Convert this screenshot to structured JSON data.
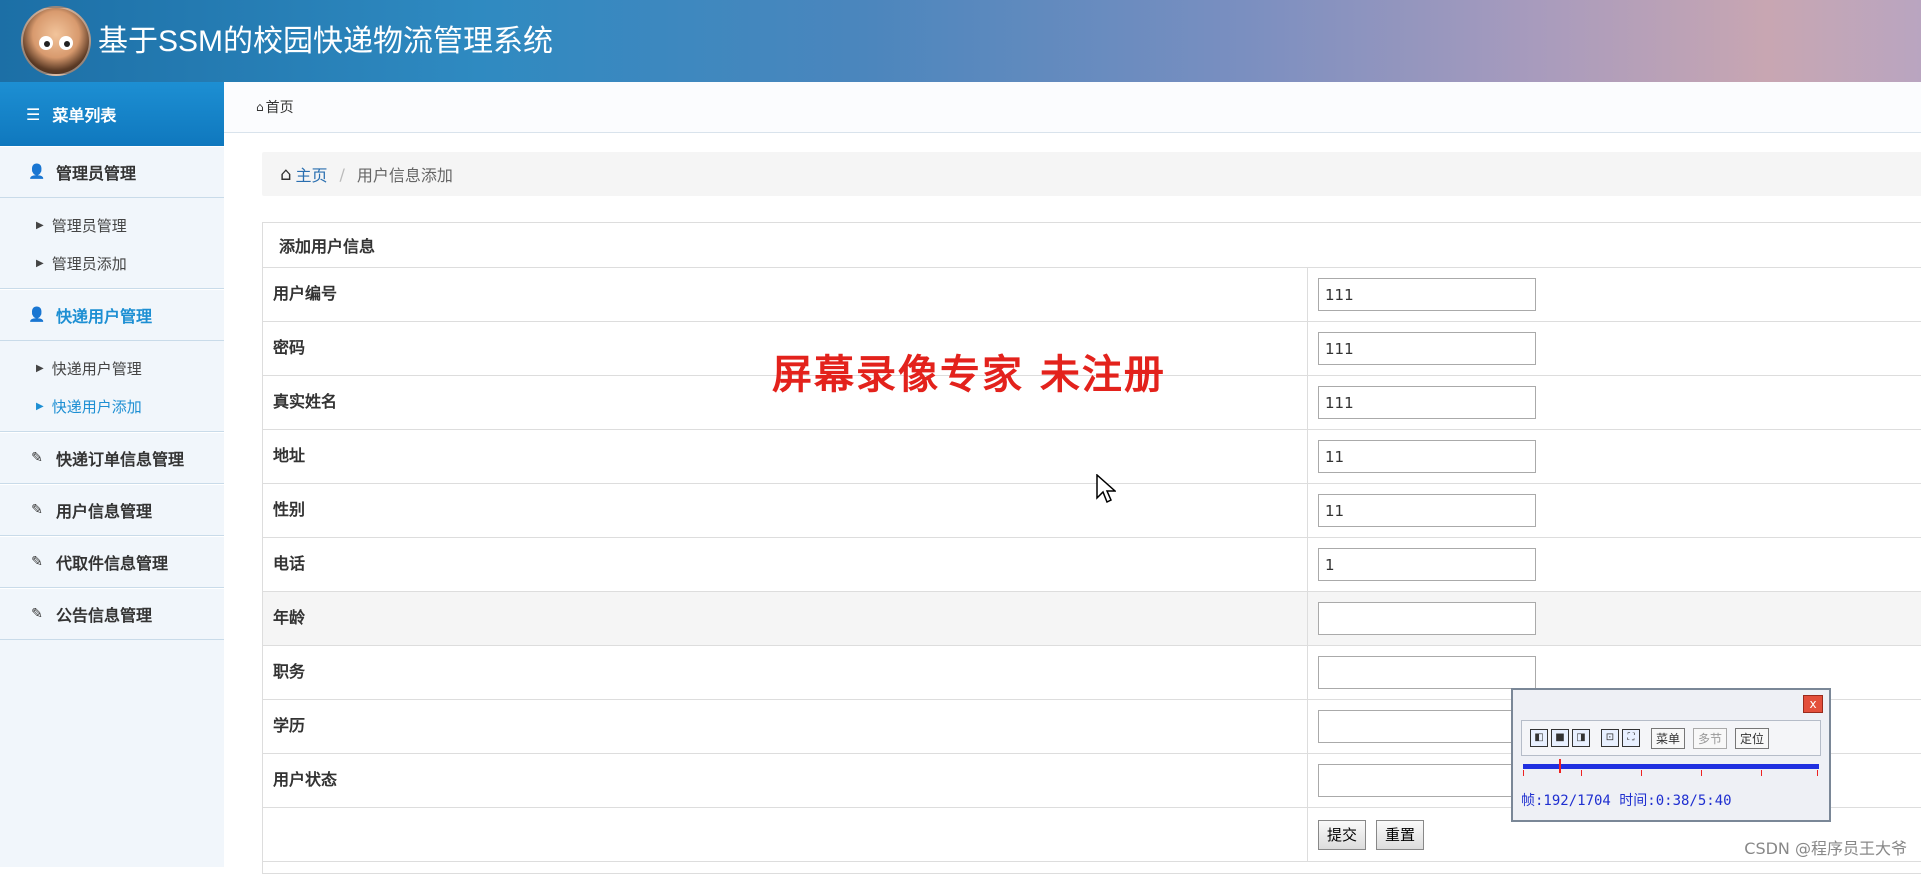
{
  "header": {
    "title": "基于SSM的校园快递物流管理系统"
  },
  "sidebar": {
    "head": {
      "label": "菜单列表",
      "icon": "list-icon"
    },
    "groups": [
      {
        "label": "管理员管理",
        "icon": "user-icon",
        "items": [
          "管理员管理",
          "管理员添加"
        ]
      },
      {
        "label": "快递用户管理",
        "icon": "user-icon",
        "items": [
          "快递用户管理",
          "快递用户添加"
        ],
        "active_item": 1
      },
      {
        "label": "快递订单信息管理",
        "icon": "edit-icon"
      },
      {
        "label": "用户信息管理",
        "icon": "edit-icon"
      },
      {
        "label": "代取件信息管理",
        "icon": "edit-icon"
      },
      {
        "label": "公告信息管理",
        "icon": "edit-icon"
      }
    ]
  },
  "topbar": {
    "home_label": "首页"
  },
  "breadcrumb": {
    "home": "主页",
    "current": "用户信息添加"
  },
  "form": {
    "title": "添加用户信息",
    "fields": [
      {
        "label": "用户编号",
        "value": "111"
      },
      {
        "label": "密码",
        "value": "111"
      },
      {
        "label": "真实姓名",
        "value": "111"
      },
      {
        "label": "地址",
        "value": "11"
      },
      {
        "label": "性别",
        "value": "11"
      },
      {
        "label": "电话",
        "value": "1"
      },
      {
        "label": "年龄",
        "value": ""
      },
      {
        "label": "职务",
        "value": ""
      },
      {
        "label": "学历",
        "value": ""
      },
      {
        "label": "用户状态",
        "value": ""
      }
    ],
    "submit_label": "提交",
    "reset_label": "重置"
  },
  "watermark": "屏幕录像专家  未注册",
  "recorder": {
    "menu_label": "菜单",
    "section_label": "多节",
    "locate_label": "定位",
    "status": "帧:192/1704 时间:0:38/5:40",
    "close": "x"
  },
  "credit": "CSDN @程序员王大爷",
  "colors": {
    "accent": "#1d8fd3",
    "watermark": "#e3221c"
  }
}
